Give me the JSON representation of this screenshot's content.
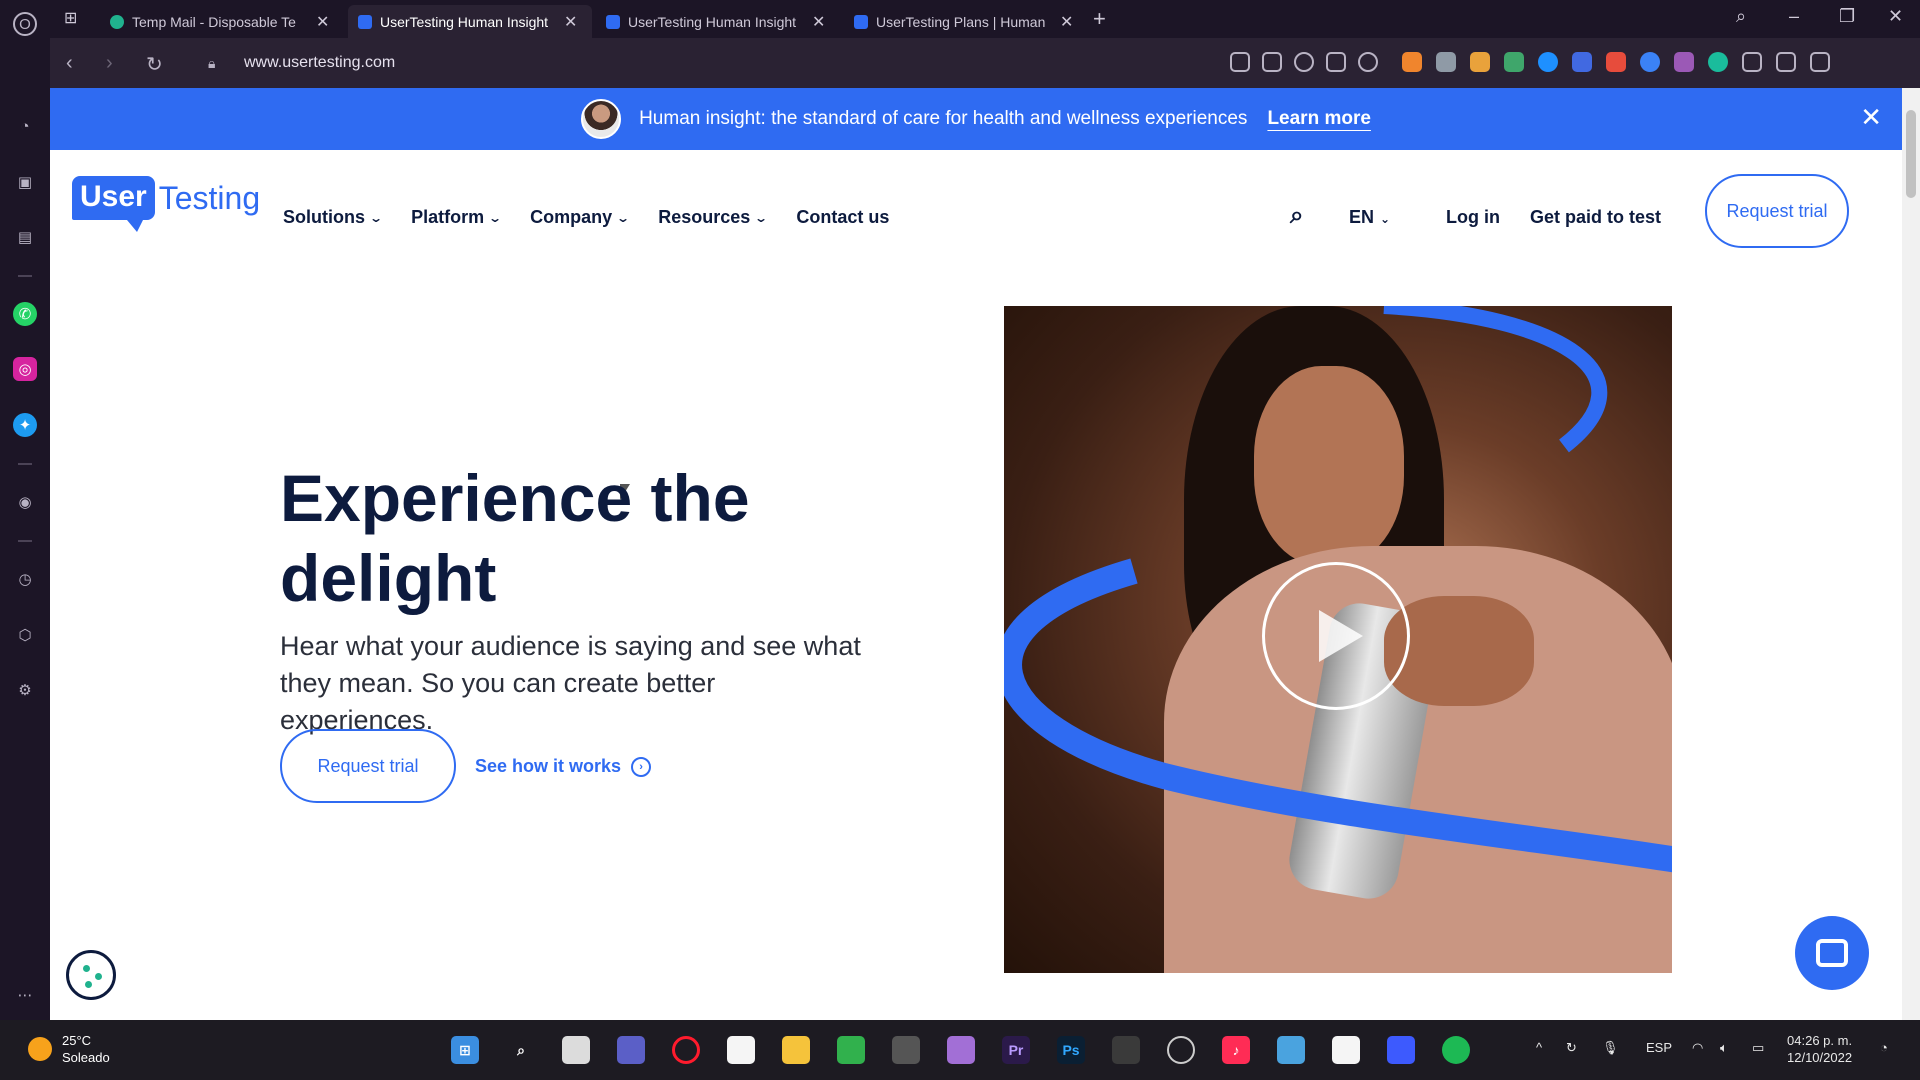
{
  "browser": {
    "tabs": [
      {
        "title": "Temp Mail - Disposable Te",
        "active": false
      },
      {
        "title": "UserTesting Human Insight",
        "active": true
      },
      {
        "title": "UserTesting Human Insight",
        "active": false
      },
      {
        "title": "UserTesting Plans | Human",
        "active": false
      }
    ],
    "url": "www.usertesting.com"
  },
  "banner": {
    "message": "Human insight: the standard of care for health and wellness experiences",
    "link": "Learn more"
  },
  "header": {
    "logo_user": "User",
    "logo_testing": "Testing",
    "menu": [
      "Solutions",
      "Platform",
      "Company",
      "Resources",
      "Contact us"
    ],
    "language": "EN",
    "login": "Log in",
    "get_paid": "Get paid to test",
    "request_trial": "Request trial"
  },
  "hero": {
    "title": "Experience the delight",
    "subtitle": "Hear what your audience is saying and see what they mean. So you can create better experiences.",
    "primary_cta": "Request trial",
    "secondary_cta": "See how it works"
  },
  "taskbar": {
    "temperature": "25°C",
    "weather": "Soleado",
    "language": "ESP",
    "time": "04:26 p. m.",
    "date": "12/10/2022"
  },
  "colors": {
    "brand_blue": "#2f6bf2",
    "navy": "#0d1b3e",
    "browser_bg": "#1c1526"
  }
}
